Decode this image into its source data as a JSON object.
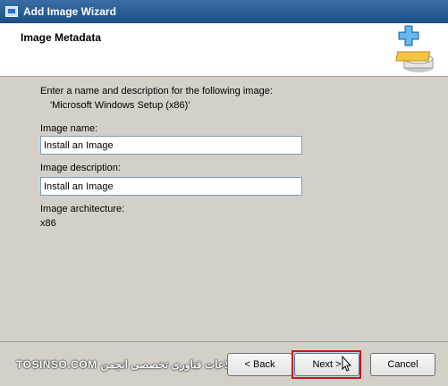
{
  "window": {
    "title": "Add Image Wizard"
  },
  "header": {
    "title": "Image Metadata"
  },
  "content": {
    "intro": "Enter a name and description for the following image:",
    "image_source": "'Microsoft Windows Setup (x86)'",
    "name_label": "Image name:",
    "name_value": "Install an Image",
    "description_label": "Image description:",
    "description_value": "Install an Image",
    "architecture_label": "Image architecture:",
    "architecture_value": "x86"
  },
  "footer": {
    "back_label": "Back",
    "next_label": "Next >",
    "cancel_label": "Cancel",
    "watermark": "TOSINSO.COM اطلاعات فناوری تخصصی انجمن"
  },
  "colors": {
    "highlight": "#d0141d",
    "titlebar": "#1c4f86"
  },
  "icons": {
    "app": "wizard-window-icon",
    "header": "add-image-plus-icon",
    "back": "back-arrow-icon",
    "cursor": "mouse-cursor-icon"
  }
}
